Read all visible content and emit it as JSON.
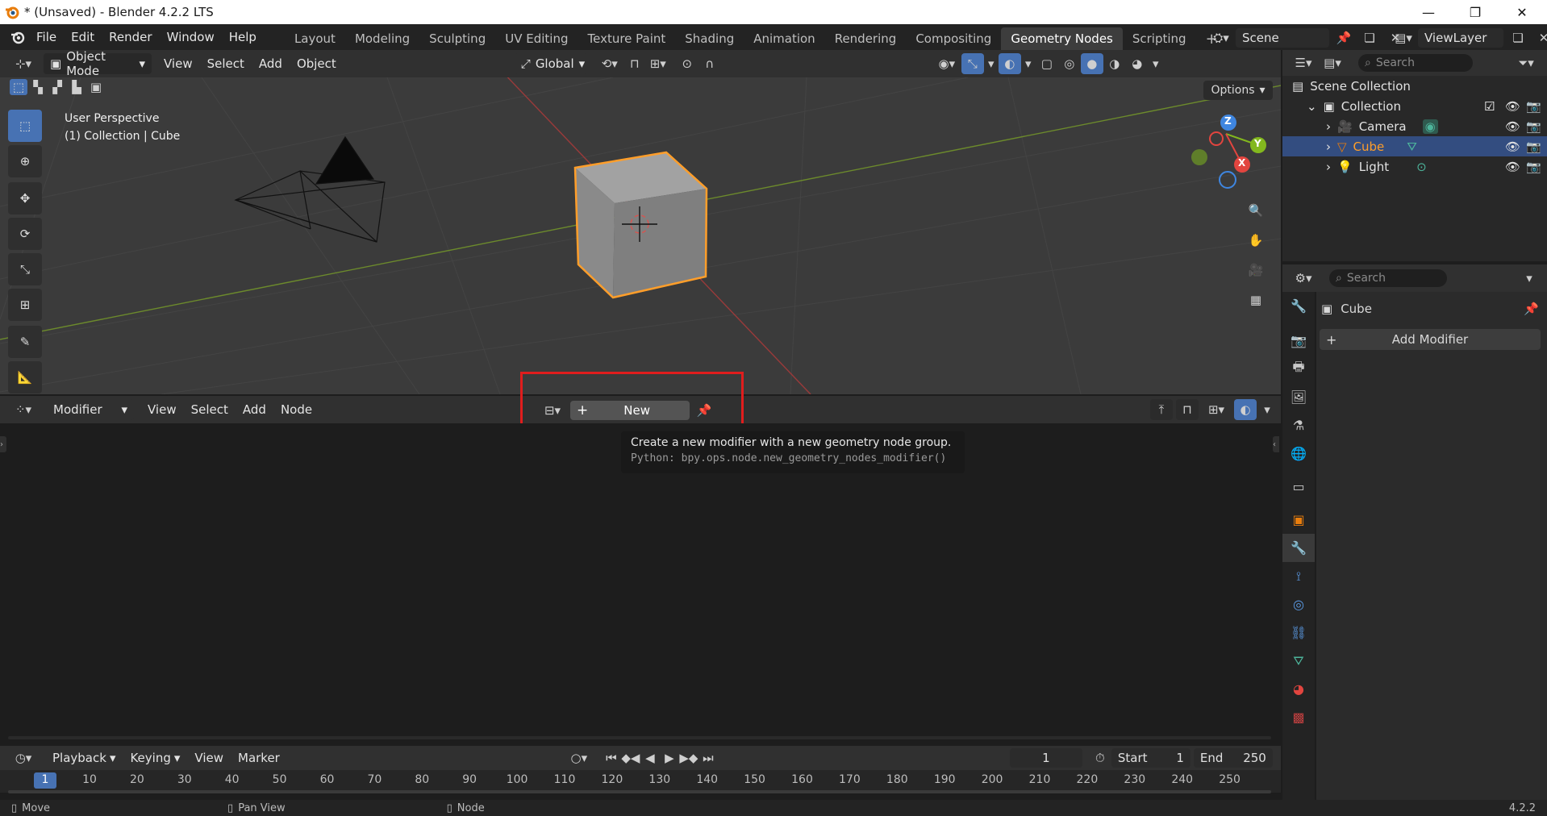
{
  "window": {
    "title": "* (Unsaved) - Blender 4.2.2 LTS",
    "minimize_glyph": "—",
    "restore_glyph": "❐",
    "close_glyph": "✕"
  },
  "menu": [
    "File",
    "Edit",
    "Render",
    "Window",
    "Help"
  ],
  "workspace_tabs": [
    "Layout",
    "Modeling",
    "Sculpting",
    "UV Editing",
    "Texture Paint",
    "Shading",
    "Animation",
    "Rendering",
    "Compositing",
    "Geometry Nodes",
    "Scripting"
  ],
  "active_workspace": "Geometry Nodes",
  "scene": {
    "name": "Scene",
    "view_layer": "ViewLayer"
  },
  "viewport": {
    "mode": "Object Mode",
    "menus": [
      "View",
      "Select",
      "Add",
      "Object"
    ],
    "transform_orientation": "Global",
    "options_label": "Options",
    "overlay_line1": "User Perspective",
    "overlay_line2": "(1) Collection | Cube",
    "gizmo": {
      "x": "X",
      "y": "Y",
      "z": "Z"
    }
  },
  "node_editor": {
    "editor_type": "Modifier",
    "menus": [
      "View",
      "Select",
      "Add",
      "Node"
    ],
    "new_button": "New",
    "tooltip_title": "Create a new modifier with a new geometry node group.",
    "tooltip_python": "Python: bpy.ops.node.new_geometry_nodes_modifier()"
  },
  "timeline": {
    "menus": [
      "Playback",
      "Keying",
      "View",
      "Marker"
    ],
    "current_frame": "1",
    "start_label": "Start",
    "start_value": "1",
    "end_label": "End",
    "end_value": "250",
    "ruler": [
      "1",
      "10",
      "20",
      "30",
      "40",
      "50",
      "60",
      "70",
      "80",
      "90",
      "100",
      "110",
      "120",
      "130",
      "140",
      "150",
      "160",
      "170",
      "180",
      "190",
      "200",
      "210",
      "220",
      "230",
      "240",
      "250"
    ]
  },
  "outliner": {
    "search_placeholder": "Search",
    "scene_collection": "Scene Collection",
    "collection": "Collection",
    "items": [
      "Camera",
      "Cube",
      "Light"
    ],
    "selected": "Cube"
  },
  "properties": {
    "search_placeholder": "Search",
    "object_name": "Cube",
    "add_modifier": "Add Modifier"
  },
  "statusbar": {
    "left": "Move",
    "middle": "Pan View",
    "right": "Node",
    "version": "4.2.2"
  },
  "colors": {
    "accent": "#4772b3",
    "selection_outline": "#ff9e2a",
    "highlight_box": "#e01d1d",
    "x_axis": "#e2453f",
    "y_axis": "#83b81e",
    "z_axis": "#3f86e0"
  }
}
